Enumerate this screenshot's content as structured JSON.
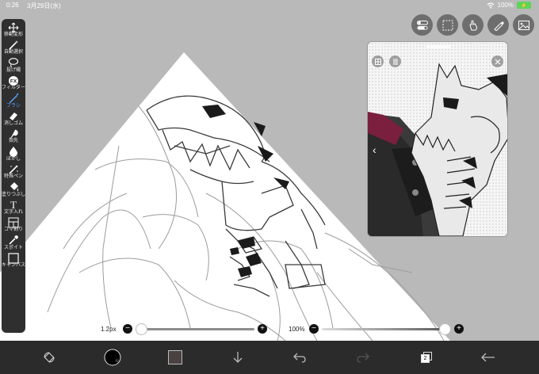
{
  "status": {
    "time": "0:26",
    "date": "3月29日(水)",
    "battery": "100%",
    "battery_color": "#5fd35a"
  },
  "tools": [
    {
      "label": "移動変形",
      "icon": "move-icon"
    },
    {
      "label": "自動選択",
      "icon": "magic-wand-icon"
    },
    {
      "label": "投げ縄",
      "icon": "lasso-icon"
    },
    {
      "label": "フィルター",
      "icon": "filter-fx-icon"
    },
    {
      "label": "ブラシ",
      "icon": "brush-icon",
      "active": true
    },
    {
      "label": "消しゴム",
      "icon": "eraser-icon"
    },
    {
      "label": "指先",
      "icon": "smudge-icon"
    },
    {
      "label": "ぼかし",
      "icon": "blur-drop-icon"
    },
    {
      "label": "特殊ペン",
      "icon": "special-pen-icon"
    },
    {
      "label": "塗りつぶし",
      "icon": "fill-bucket-icon"
    },
    {
      "label": "文字入れ",
      "icon": "text-tool-icon"
    },
    {
      "label": "コマ割り",
      "icon": "panel-divide-icon"
    },
    {
      "label": "スポイト",
      "icon": "eyedropper-icon"
    },
    {
      "label": "キャンバス",
      "icon": "canvas-icon"
    }
  ],
  "top_buttons": [
    "toggle-icon",
    "selection-icon",
    "gesture-icon",
    "ruler-pen-icon",
    "image-icon"
  ],
  "brush": {
    "size_label": "1.2px",
    "size_fraction": 0.0,
    "opacity_label": "100%",
    "opacity_fraction": 1.0,
    "minus": "−",
    "plus": "+"
  },
  "bottom": {
    "current_color": "#4a4141",
    "layers_count": "2",
    "icons": [
      "rotate-view-icon",
      "brush-preview-icon",
      "color-swatch-icon",
      "download-icon",
      "undo-icon",
      "redo-icon",
      "layers-icon",
      "back-arrow-icon"
    ]
  },
  "reference": {
    "accent": "#7a1f3d"
  }
}
